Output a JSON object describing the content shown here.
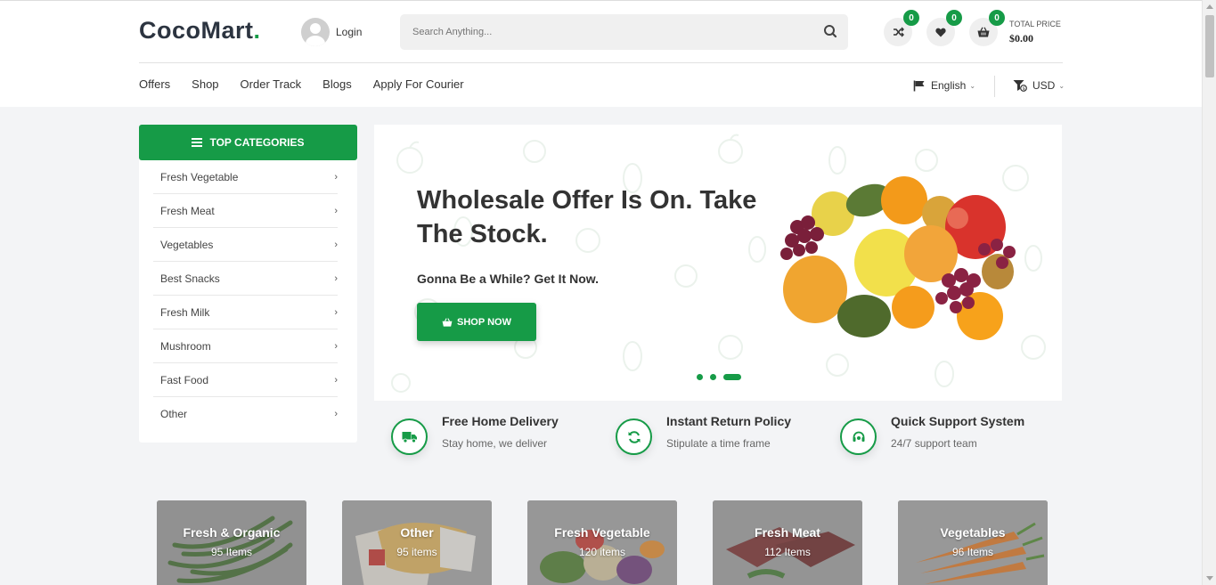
{
  "brand": {
    "name_part1": "CocoMart",
    "name_part2": "."
  },
  "header": {
    "login_label": "Login",
    "search_placeholder": "Search Anything...",
    "compare_count": "0",
    "wishlist_count": "0",
    "cart_count": "0",
    "total_label": "TOTAL PRICE",
    "total_value": "$0.00"
  },
  "nav": {
    "items": [
      "Offers",
      "Shop",
      "Order Track",
      "Blogs",
      "Apply For Courier"
    ],
    "language": "English",
    "currency": "USD"
  },
  "categories": {
    "title": "TOP CATEGORIES",
    "items": [
      "Fresh Vegetable",
      "Fresh Meat",
      "Vegetables",
      "Best Snacks",
      "Fresh Milk",
      "Mushroom",
      "Fast Food",
      "Other"
    ]
  },
  "banner": {
    "title": "Wholesale Offer Is On. Take The Stock.",
    "subtitle": "Gonna Be a While? Get It Now.",
    "button_label": "SHOP NOW",
    "slide_count": 3,
    "active_slide": 3
  },
  "features": [
    {
      "title": "Free Home Delivery",
      "desc": "Stay home, we deliver",
      "icon": "truck-icon"
    },
    {
      "title": "Instant Return Policy",
      "desc": "Stipulate a time frame",
      "icon": "refresh-icon"
    },
    {
      "title": "Quick Support System",
      "desc": "24/7 support team",
      "icon": "headset-icon"
    }
  ],
  "category_cards": [
    {
      "title": "Fresh & Organic",
      "count": "95 Items"
    },
    {
      "title": "Other",
      "count": "95 items"
    },
    {
      "title": "Fresh Vegetable",
      "count": "120 items"
    },
    {
      "title": "Fresh Meat",
      "count": "112 Items"
    },
    {
      "title": "Vegetables",
      "count": "96 Items"
    }
  ],
  "colors": {
    "brand_green": "#169b47",
    "dark_text": "#2c3440",
    "page_bg": "#f3f4f6"
  }
}
